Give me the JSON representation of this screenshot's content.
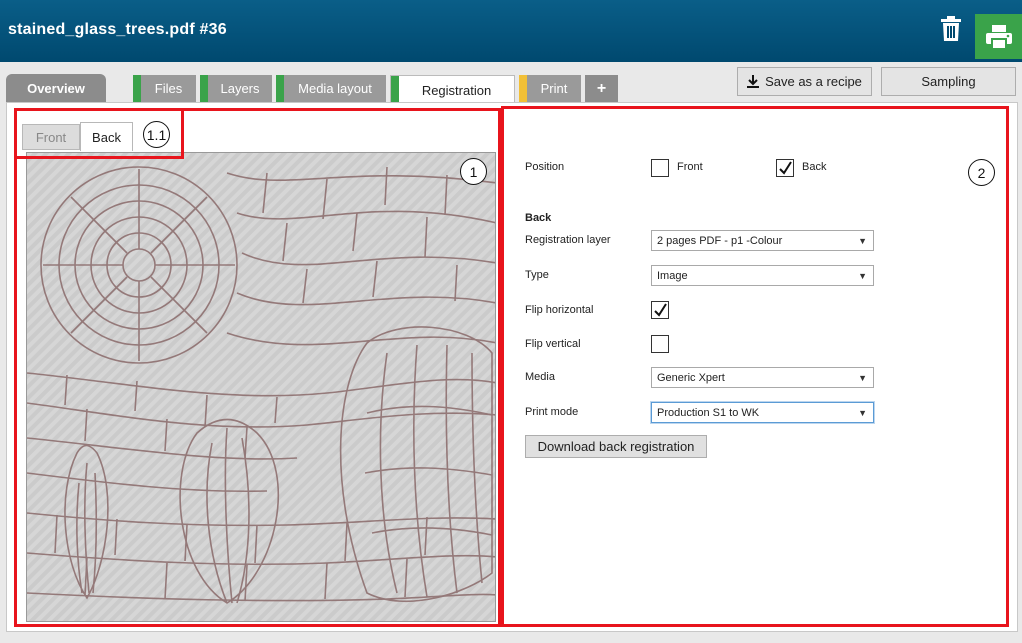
{
  "header": {
    "title": "stained_glass_trees.pdf #36",
    "delete_icon": "trash-icon",
    "print_icon": "printer-icon"
  },
  "tabs": [
    {
      "label": "Overview",
      "status": "none"
    },
    {
      "label": "Files",
      "status": "ok"
    },
    {
      "label": "Layers",
      "status": "ok"
    },
    {
      "label": "Media layout",
      "status": "ok"
    },
    {
      "label": "Registration",
      "status": "ok",
      "active": true
    },
    {
      "label": "Print",
      "status": "warning"
    },
    {
      "label": "+",
      "status": "add"
    }
  ],
  "toolbar": {
    "save_recipe_label": "Save as a recipe",
    "sampling_label": "Sampling"
  },
  "sides": {
    "front_label": "Front",
    "back_label": "Back",
    "active": "Back"
  },
  "callouts": {
    "sides_tabs": "1.1",
    "preview": "1",
    "settings": "2"
  },
  "settings": {
    "position_label": "Position",
    "position_front_label": "Front",
    "position_back_label": "Back",
    "position_front_checked": false,
    "position_back_checked": true,
    "section_title": "Back",
    "registration_layer_label": "Registration layer",
    "registration_layer_value": "2 pages PDF - p1 -Colour",
    "type_label": "Type",
    "type_value": "Image",
    "flip_horizontal_label": "Flip horizontal",
    "flip_horizontal_checked": true,
    "flip_vertical_label": "Flip vertical",
    "flip_vertical_checked": false,
    "media_label": "Media",
    "media_value": "Generic Xpert",
    "print_mode_label": "Print mode",
    "print_mode_value": "Production S1 to WK",
    "download_label": "Download back registration"
  },
  "colors": {
    "header": "#00496f",
    "status_ok": "#3aa34a",
    "status_warning": "#f2c037",
    "callout_box": "#e8141c",
    "print_button": "#3aa34a"
  }
}
